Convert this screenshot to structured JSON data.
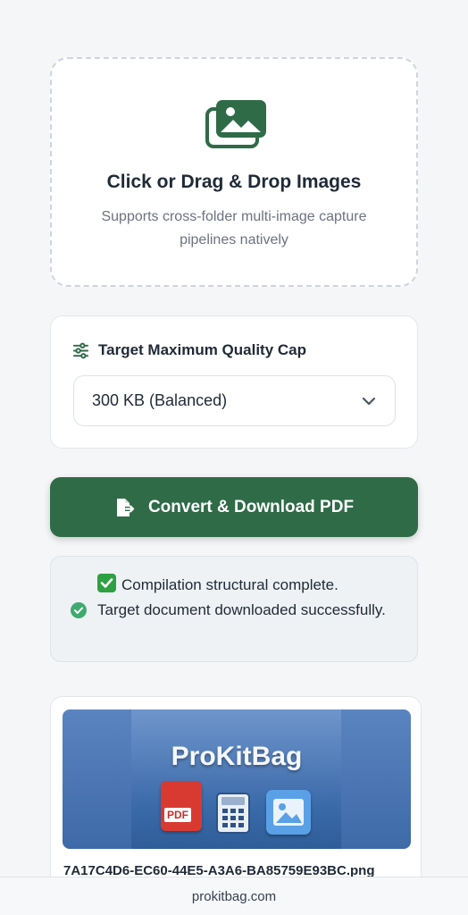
{
  "upload": {
    "title": "Click or Drag & Drop Images",
    "subtitle": "Supports cross-folder multi-image capture pipelines natively",
    "icon": "images-stack-icon"
  },
  "quality": {
    "label": "Target Maximum Quality Cap",
    "icon": "sliders-icon",
    "selected": "300 KB (Balanced)"
  },
  "convert": {
    "label": "Convert & Download PDF",
    "icon": "file-export-icon"
  },
  "status": {
    "line1": "Compilation structural complete.",
    "line2": "Target document downloaded successfully.",
    "icon": "check-circle-icon"
  },
  "preview": {
    "brand": "ProKitBag",
    "pdf_label": "PDF",
    "filename": "7A17C4D6-EC60-44E5-A3A6-BA85759E93BC.png"
  },
  "footer": {
    "domain": "prokitbag.com"
  },
  "colors": {
    "accent": "#2f6b47",
    "success": "#3faa6f"
  }
}
